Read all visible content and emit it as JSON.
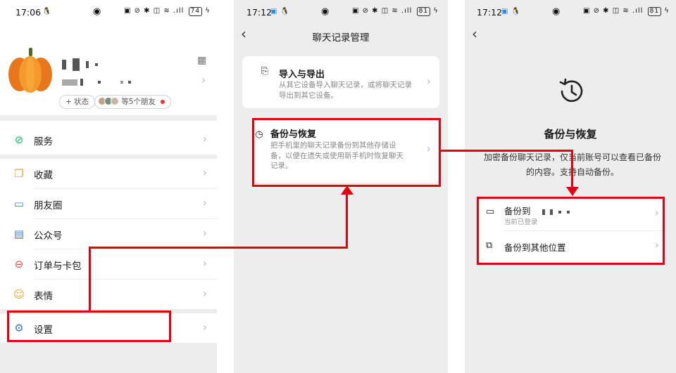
{
  "panel1": {
    "time": "17:06",
    "battery": "74",
    "qr_icon": "qr-code-icon",
    "status_pill": "+ 状态",
    "friends_pill": "等5个朋友",
    "menu": [
      {
        "label": "服务",
        "icon": "service-icon"
      },
      {
        "label": "收藏",
        "icon": "favorites-icon"
      },
      {
        "label": "朋友圈",
        "icon": "moments-icon"
      },
      {
        "label": "公众号",
        "icon": "official-accounts-icon"
      },
      {
        "label": "订单与卡包",
        "icon": "orders-cards-icon"
      },
      {
        "label": "表情",
        "icon": "stickers-icon"
      },
      {
        "label": "设置",
        "icon": "settings-gear-icon"
      }
    ]
  },
  "panel2": {
    "time": "17:12",
    "battery": "81",
    "title": "聊天记录管理",
    "import": {
      "title": "导入与导出",
      "desc": "从其它设备导入聊天记录，或将聊天记录导出到其它设备。"
    },
    "backup": {
      "title": "备份与恢复",
      "desc": "把手机里的聊天记录备份到其他存储设备，以便在遗失或使用新手机时恢复聊天记录。"
    }
  },
  "panel3": {
    "time": "17:12",
    "battery": "81",
    "title": "备份与恢复",
    "desc": "加密备份聊天记录，仅当前账号可以查看已备份的内容。支持自动备份。",
    "option1_label": "备份到",
    "option1_sub": "当前已登录",
    "option2_label": "备份到其他位置"
  },
  "colors": {
    "highlight": "#e3000f",
    "bg_gray": "#ededed",
    "wechat_green": "#07c160"
  }
}
